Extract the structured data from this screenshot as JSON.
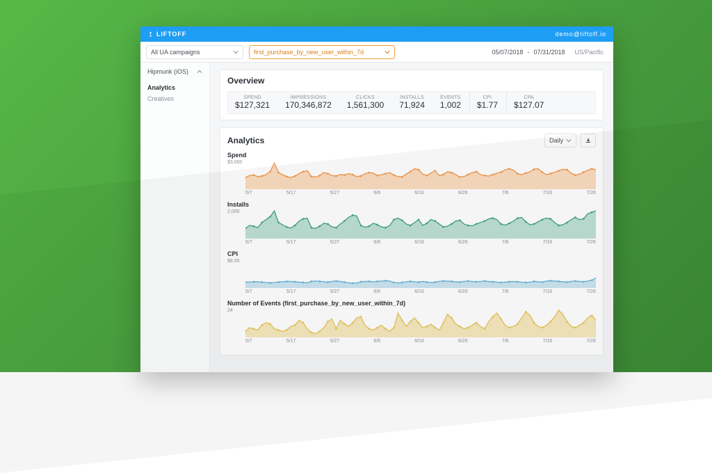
{
  "brand": "LIFTOFF",
  "user_email": "demo@liftoff.io",
  "filters": {
    "campaign": "All UA campaigns",
    "event": "first_purchase_by_new_user_within_7d",
    "date_from": "05/07/2018",
    "date_to": "07/31/2018",
    "timezone": "US/Pacific"
  },
  "sidebar": {
    "account": "Hipmunk (iOS)",
    "items": [
      {
        "label": "Analytics",
        "active": true
      },
      {
        "label": "Creatives",
        "active": false
      }
    ]
  },
  "overview": {
    "title": "Overview",
    "funnel": [
      {
        "label": "SPEND",
        "value": "$127,321"
      },
      {
        "label": "IMPRESSIONS",
        "value": "170,346,872"
      },
      {
        "label": "CLICKS",
        "value": "1,561,300"
      },
      {
        "label": "INSTALLS",
        "value": "71,924"
      },
      {
        "label": "EVENTS",
        "value": "1,002"
      }
    ],
    "metrics": [
      {
        "label": "CPI",
        "value": "$1.77"
      },
      {
        "label": "CPA",
        "value": "$127.07"
      }
    ]
  },
  "analytics": {
    "title": "Analytics",
    "granularity": "Daily",
    "charts": [
      {
        "id": "spend",
        "title": "Spend",
        "ylabel": "$3,000",
        "color": "#f39a4b",
        "fill": "rgba(243,154,75,.35)"
      },
      {
        "id": "installs",
        "title": "Installs",
        "ylabel": "2,000",
        "color": "#44a585",
        "fill": "rgba(68,165,133,.35)"
      },
      {
        "id": "cpi",
        "title": "CPI",
        "ylabel": "$8.00",
        "color": "#6bb5d8",
        "fill": "rgba(107,181,216,.35)"
      },
      {
        "id": "events",
        "title": "Number of Events (first_purchase_by_new_user_within_7d)",
        "ylabel": "24",
        "color": "#e8c659",
        "fill": "rgba(232,198,89,.40)"
      }
    ],
    "xticks": [
      "5/7",
      "5/17",
      "5/27",
      "6/6",
      "6/16",
      "6/26",
      "7/6",
      "7/16",
      "7/26"
    ]
  },
  "chart_data": [
    {
      "type": "area",
      "id": "spend",
      "title": "Spend",
      "xlabel": "",
      "ylabel": "$",
      "ylim": [
        0,
        3000
      ],
      "x_ticks": [
        "5/7",
        "5/17",
        "5/27",
        "6/6",
        "6/16",
        "6/26",
        "7/6",
        "7/16",
        "7/26"
      ],
      "values": [
        1200,
        1400,
        1450,
        1300,
        1350,
        1500,
        1800,
        2700,
        1700,
        1500,
        1300,
        1200,
        1350,
        1600,
        1800,
        1900,
        1300,
        1250,
        1400,
        1700,
        1600,
        1400,
        1350,
        1500,
        1450,
        1600,
        1500,
        1300,
        1350,
        1600,
        1700,
        1650,
        1400,
        1500,
        1600,
        1700,
        1450,
        1300,
        1250,
        1550,
        1800,
        2100,
        2000,
        1550,
        1400,
        1650,
        1900,
        1400,
        1500,
        1800,
        1700,
        1500,
        1250,
        1300,
        1500,
        1700,
        1800,
        1500,
        1400,
        1350,
        1500,
        1650,
        1750,
        2000,
        2100,
        1950,
        1600,
        1500,
        1650,
        1800,
        2050,
        2100,
        1750,
        1500,
        1600,
        1750,
        1900,
        2050,
        2000,
        1650,
        1450,
        1550,
        1750,
        1950,
        2100,
        2000
      ]
    },
    {
      "type": "area",
      "id": "installs",
      "title": "Installs",
      "xlabel": "",
      "ylabel": "installs",
      "ylim": [
        0,
        2000
      ],
      "x_ticks": [
        "5/7",
        "5/17",
        "5/27",
        "6/6",
        "6/16",
        "6/26",
        "7/6",
        "7/16",
        "7/26"
      ],
      "values": [
        700,
        900,
        850,
        750,
        1100,
        1300,
        1500,
        1900,
        1100,
        950,
        800,
        720,
        900,
        1200,
        1350,
        1400,
        750,
        700,
        850,
        1050,
        1000,
        800,
        750,
        1000,
        1200,
        1450,
        1600,
        1550,
        900,
        780,
        850,
        1050,
        950,
        800,
        750,
        900,
        1300,
        1400,
        1250,
        1000,
        900,
        1100,
        1300,
        900,
        1050,
        1300,
        1200,
        1000,
        800,
        850,
        1000,
        1200,
        1250,
        1000,
        900,
        870,
        1000,
        1100,
        1200,
        1350,
        1400,
        1300,
        1000,
        920,
        1050,
        1200,
        1400,
        1450,
        1150,
        950,
        1000,
        1150,
        1300,
        1400,
        1350,
        1100,
        900,
        950,
        1100,
        1300,
        1450,
        1300,
        1350,
        1700,
        1800,
        1900
      ]
    },
    {
      "type": "area",
      "id": "cpi",
      "title": "CPI",
      "xlabel": "",
      "ylabel": "$",
      "ylim": [
        0,
        8
      ],
      "x_ticks": [
        "5/7",
        "5/17",
        "5/27",
        "6/6",
        "6/16",
        "6/26",
        "7/6",
        "7/16",
        "7/26"
      ],
      "values": [
        1.6,
        1.6,
        1.7,
        1.7,
        1.6,
        1.5,
        1.4,
        1.5,
        1.6,
        1.7,
        1.8,
        1.8,
        1.7,
        1.6,
        1.5,
        1.4,
        1.8,
        1.9,
        1.8,
        1.7,
        1.6,
        1.8,
        1.9,
        1.8,
        1.6,
        1.4,
        1.3,
        1.4,
        1.7,
        1.8,
        1.8,
        1.7,
        1.8,
        1.9,
        2.0,
        1.9,
        1.5,
        1.4,
        1.5,
        1.7,
        1.8,
        1.7,
        1.6,
        1.8,
        1.6,
        1.5,
        1.6,
        1.8,
        1.9,
        1.9,
        1.8,
        1.7,
        1.6,
        1.8,
        1.9,
        1.8,
        1.7,
        1.8,
        1.9,
        1.8,
        1.7,
        1.6,
        1.5,
        1.6,
        1.7,
        1.8,
        1.7,
        1.6,
        1.5,
        1.6,
        1.8,
        1.7,
        1.6,
        1.9,
        2.0,
        1.9,
        1.8,
        1.7,
        1.6,
        1.8,
        1.9,
        1.8,
        1.7,
        1.9,
        2.1,
        2.8
      ]
    },
    {
      "type": "area",
      "id": "events",
      "title": "Number of Events (first_purchase_by_new_user_within_7d)",
      "xlabel": "",
      "ylabel": "events",
      "ylim": [
        0,
        24
      ],
      "x_ticks": [
        "5/7",
        "5/17",
        "5/27",
        "6/6",
        "6/16",
        "6/26",
        "7/6",
        "7/16",
        "7/26"
      ],
      "values": [
        5,
        8,
        7,
        6,
        10,
        12,
        11,
        7,
        6,
        5,
        6,
        9,
        10,
        14,
        12,
        7,
        4,
        3,
        5,
        8,
        13,
        15,
        7,
        14,
        11,
        9,
        12,
        16,
        17,
        10,
        7,
        6,
        8,
        10,
        7,
        5,
        8,
        20,
        14,
        9,
        13,
        16,
        12,
        8,
        9,
        11,
        8,
        6,
        12,
        19,
        16,
        11,
        9,
        7,
        8,
        10,
        12,
        9,
        7,
        13,
        17,
        20,
        15,
        10,
        8,
        9,
        11,
        16,
        21,
        18,
        12,
        9,
        8,
        10,
        13,
        17,
        22,
        19,
        13,
        9,
        8,
        10,
        12,
        16,
        18,
        14
      ]
    }
  ]
}
